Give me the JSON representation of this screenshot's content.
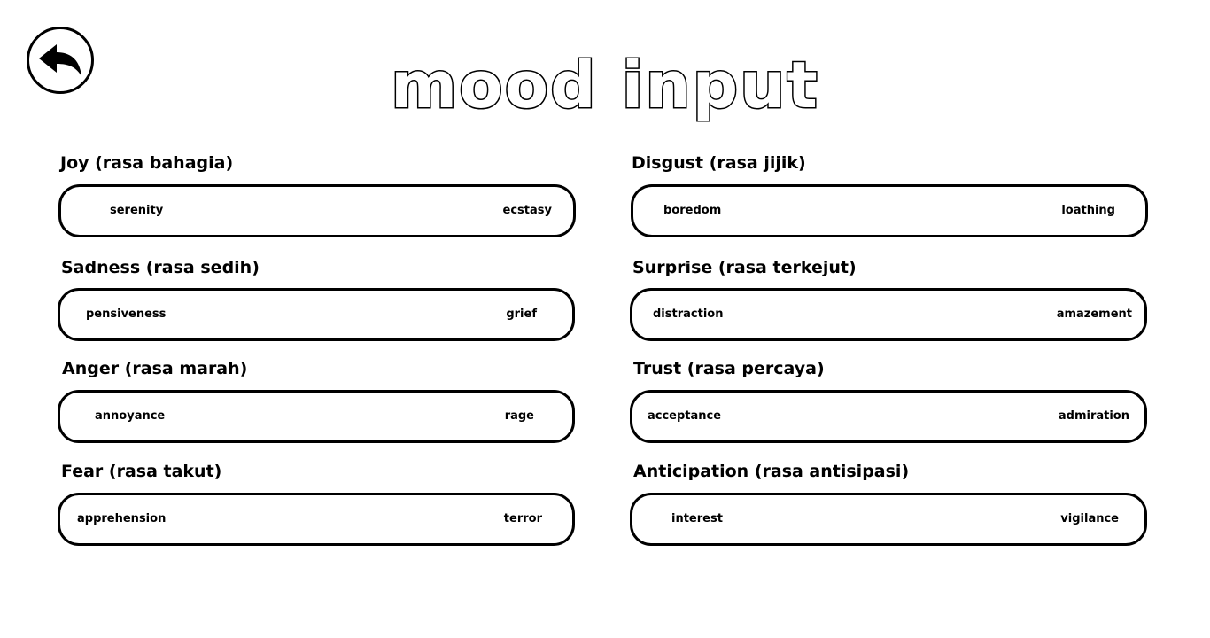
{
  "title": "mood input",
  "back_button": {
    "icon": "reply-arrow-icon"
  },
  "moods": [
    {
      "label": "Joy (rasa bahagia)",
      "low": "serenity",
      "high": "ecstasy"
    },
    {
      "label": "Sadness (rasa sedih)",
      "low": "pensiveness",
      "high": "grief"
    },
    {
      "label": "Anger (rasa marah)",
      "low": "annoyance",
      "high": "rage"
    },
    {
      "label": "Fear (rasa takut)",
      "low": "apprehension",
      "high": "terror"
    },
    {
      "label": "Disgust (rasa jijik)",
      "low": "boredom",
      "high": "loathing"
    },
    {
      "label": "Surprise (rasa terkejut)",
      "low": "distraction",
      "high": "amazement"
    },
    {
      "label": "Trust (rasa percaya)",
      "low": "acceptance",
      "high": "admiration"
    },
    {
      "label": "Anticipation (rasa antisipasi)",
      "low": "interest",
      "high": "vigilance"
    }
  ]
}
